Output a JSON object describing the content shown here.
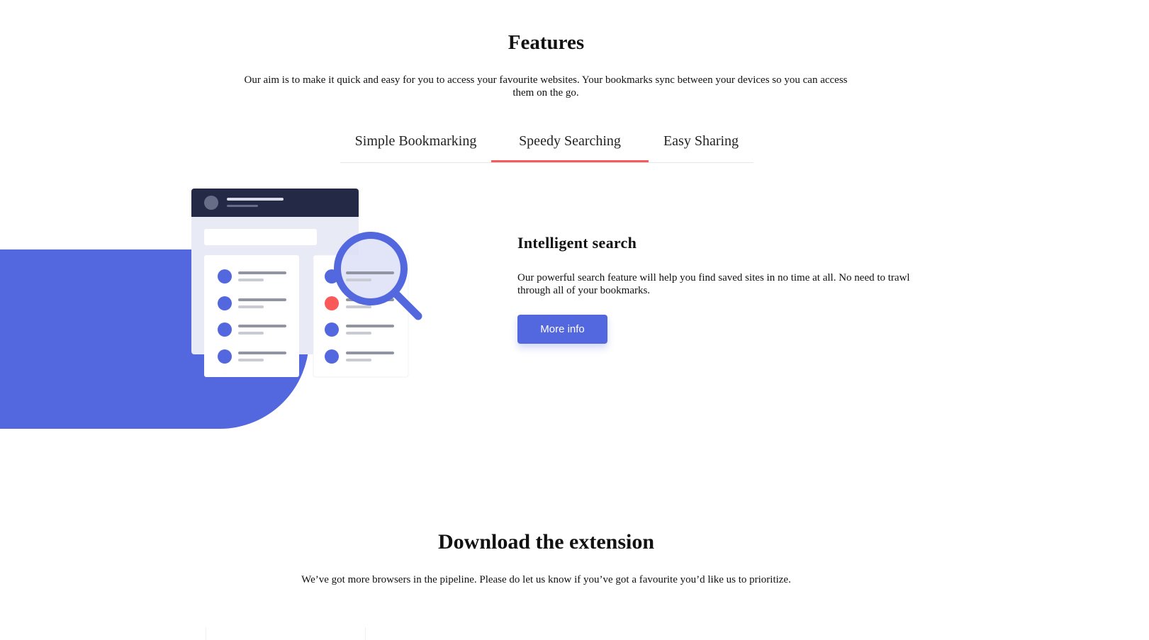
{
  "features": {
    "title": "Features",
    "description": "Our aim is to make it quick and easy for you to access your favourite websites. Your bookmarks sync between your devices so you can access them on the go."
  },
  "tabs": [
    {
      "label": "Simple Bookmarking",
      "active": false
    },
    {
      "label": "Speedy Searching",
      "active": true
    },
    {
      "label": "Easy Sharing",
      "active": false
    }
  ],
  "panel": {
    "title": "Intelligent search",
    "description": "Our powerful search feature will help you find saved sites in no time at all. No need to trawl through all of your bookmarks.",
    "button_label": "More info"
  },
  "download": {
    "title": "Download the extension",
    "description": "We’ve got more browsers in the pipeline. Please do let us know if you’ve got a favourite you’d like us to prioritize."
  },
  "colors": {
    "accent_blue": "#5368df",
    "accent_red": "#fa5959",
    "dark_navy": "#242a45"
  }
}
